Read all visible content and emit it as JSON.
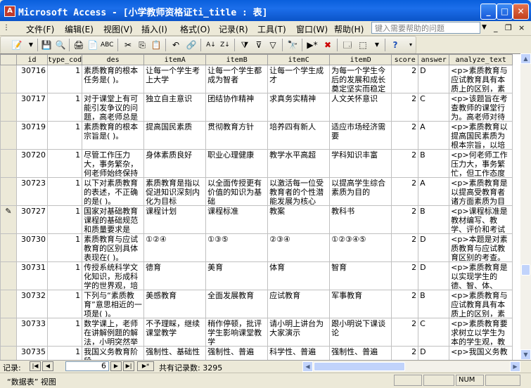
{
  "window": {
    "title": "Microsoft Access - [小学教师资格证ti_title : 表]",
    "minimize": "_",
    "maximize": "□",
    "close": "✕"
  },
  "menubar": {
    "items": [
      "文件(F)",
      "编辑(E)",
      "视图(V)",
      "插入(I)",
      "格式(O)",
      "记录(R)",
      "工具(T)",
      "窗口(W)",
      "帮助(H)"
    ],
    "help_placeholder": "键入需要帮助的问题",
    "mdi_min": "_",
    "mdi_restore": "❐",
    "mdi_close": "×"
  },
  "toolbar": {
    "icons": [
      "view-design-icon",
      "save-icon",
      "search-file-icon",
      "print-icon",
      "print-preview-icon",
      "spelling-icon",
      "cut-icon",
      "copy-icon",
      "paste-icon",
      "undo-icon",
      "sort-asc-icon",
      "sort-desc-icon",
      "filter-selection-icon",
      "filter-form-icon",
      "apply-filter-icon",
      "find-icon",
      "new-record-icon",
      "delete-record-icon",
      "database-window-icon",
      "new-object-icon",
      "help-icon"
    ]
  },
  "grid": {
    "columns": [
      "id",
      "type_cod",
      "des",
      "itemA",
      "itemB",
      "itemC",
      "itemD",
      "score",
      "answer",
      "analyze_text"
    ],
    "rows": [
      {
        "selector": "",
        "id": "30716",
        "type_code": "1",
        "des": "素质教育的根本任务是( )。",
        "itemA": "让每一个学生考上大学",
        "itemB": "让每一个学生都成为智者",
        "itemC": "让每一个学生成才",
        "itemD": "为每一个学生今后的发展和成长奠定坚实而稳定",
        "score": "2",
        "answer": "D",
        "analyze": "<p>素质教育与应试教育具有本质上的区别，素"
      },
      {
        "selector": "",
        "id": "30717",
        "type_code": "1",
        "des": "对于课堂上有可能引发争议的问题，高老师总是",
        "itemA": "独立自主意识",
        "itemB": "团结协作精神",
        "itemC": "求真务实精神",
        "itemD": "人文关怀意识",
        "score": "2",
        "answer": "C",
        "analyze": "<p>该题旨在考查教师的课堂行为。高老师对待"
      },
      {
        "selector": "",
        "id": "30719",
        "type_code": "1",
        "des": "素质教育的根本宗旨是( )。",
        "itemA": "提高国民素质",
        "itemB": "贯彻教育方针",
        "itemC": "培养四有新人",
        "itemD": "适应市场经济需要",
        "score": "2",
        "answer": "A",
        "analyze": "<p>素质教育以提高国民素质为根本宗旨，以培"
      },
      {
        "selector": "",
        "id": "30720",
        "type_code": "1",
        "des": "尽管工作压力大，事务繁杂，何老师始终保持",
        "itemA": "身体素质良好",
        "itemB": "职业心理健康",
        "itemC": "教学水平高超",
        "itemD": "学科知识丰富",
        "score": "2",
        "answer": "B",
        "analyze": "<p>何老师工作压力大，事务繁忙，但工作态度"
      },
      {
        "selector": "",
        "id": "30723",
        "type_code": "1",
        "des": "以下对素质教育的表述，不正确的是( )。",
        "itemA": "素质教育是指以促进知识深刻内化为目标",
        "itemB": "以全面传授更有价值的知识为基础",
        "itemC": "以激活每一位受教育者的个性潜能发展为核心",
        "itemD": "以提高学生综合素质为目的",
        "score": "2",
        "answer": "A",
        "analyze": "<p>素质教育是以提高受教育者诸方面素质为目"
      },
      {
        "selector": "✎",
        "id": "30727",
        "type_code": "1",
        "des": "国家对基础教育课程的基础规范和质量要求是",
        "itemA": "课程计划",
        "itemB": "课程标准",
        "itemC": "教案",
        "itemD": "教科书",
        "score": "2",
        "answer": "B",
        "analyze": "<p>课程标准是教材编写、教学、评价和考试命"
      },
      {
        "selector": "",
        "id": "30730",
        "type_code": "1",
        "des": "素质教育与应试教育的区别具体表现在( )。",
        "itemA": "①②④",
        "itemB": "①③⑤",
        "itemC": "②③④",
        "itemD": "①②③④⑤",
        "score": "2",
        "answer": "D",
        "analyze": "<p>本题是对素质教育与应试教育区别的考查。"
      },
      {
        "selector": "",
        "id": "30731",
        "type_code": "1",
        "des": "传授系统科学文化知识，形成科学的世界观，培",
        "itemA": "德育",
        "itemB": "美育",
        "itemC": "体育",
        "itemD": "智育",
        "score": "2",
        "answer": "D",
        "analyze": "<p>素质教育是以实现学生的德、智、体、"
      },
      {
        "selector": "",
        "id": "30732",
        "type_code": "1",
        "des": "下列与“素质教育”意思相近的一项是( )。",
        "itemA": "美感教育",
        "itemB": "全面发展教育",
        "itemC": "应试教育",
        "itemD": "军事教育",
        "score": "2",
        "answer": "B",
        "analyze": "<p>素质教育与应试教育具有本质上的区别，素"
      },
      {
        "selector": "",
        "id": "30733",
        "type_code": "1",
        "des": "数学课上，老师在讲解例题的解法，小明突然举",
        "itemA": "不予理睬，继续课堂教学",
        "itemB": "稍作停顿，批评学生影响课堂教学",
        "itemC": "请小明上讲台为大家演示",
        "itemD": "跟小明说下课谈论",
        "score": "2",
        "answer": "C",
        "analyze": "<p>素质教育要求树立以学生为本的学生观，教"
      },
      {
        "selector": "",
        "id": "30735",
        "type_code": "1",
        "des": "我国义务教育阶段",
        "itemA": "强制性、基础性",
        "itemB": "强制性、普遍",
        "itemC": "科学性、普遍",
        "itemD": "强制性、普遍",
        "score": "2",
        "answer": "D",
        "analyze": "<p>我国义务教"
      }
    ]
  },
  "navigation": {
    "record_label": "记录:",
    "current_record": "6",
    "total_label": "共有记录数: 3295",
    "first": "|◀",
    "prev": "◀",
    "next": "▶",
    "last": "▶|",
    "new": "▶*"
  },
  "statusbar": {
    "view": "“数据表” 视图",
    "num": "NUM"
  }
}
